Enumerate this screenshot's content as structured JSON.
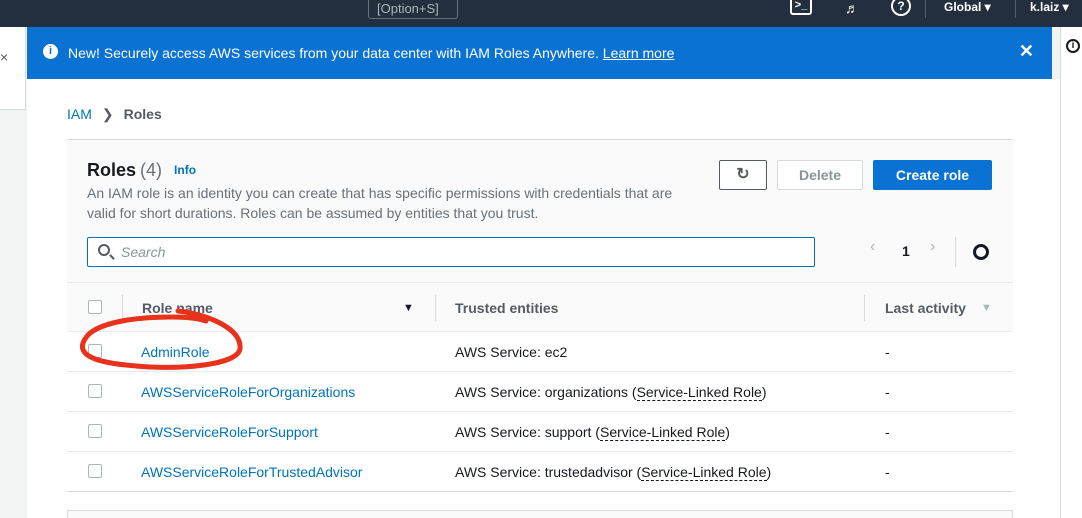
{
  "topnav": {
    "shortcut_hint": "[Option+S]",
    "cloudshell_icon": "cloudshell-icon",
    "bell_icon": "bell-icon",
    "help_icon": "help-icon",
    "region": "Global ▾",
    "user": "k.laiz ▾"
  },
  "banner": {
    "message": "New! Securely access AWS services from your data center with IAM Roles Anywhere.",
    "link": "Learn more",
    "color": "#0972d3"
  },
  "breadcrumb": {
    "root": "IAM",
    "current": "Roles"
  },
  "roles_panel": {
    "title": "Roles",
    "count": "(4)",
    "info_link": "Info",
    "description": "An IAM role is an identity you can create that has specific permissions with credentials that are valid for short durations. Roles can be assumed by entities that you trust.",
    "refresh_icon": "refresh-icon",
    "delete_label": "Delete",
    "create_label": "Create role",
    "search_placeholder": "Search",
    "page_number": "1"
  },
  "table": {
    "columns": [
      "Role name",
      "Trusted entities",
      "Last activity"
    ],
    "rows": [
      {
        "name": "AdminRole",
        "trusted": "AWS Service: ec2",
        "linked": "",
        "last": "-"
      },
      {
        "name": "AWSServiceRoleForOrganizations",
        "trusted": "AWS Service: organizations (",
        "linked": "Service-Linked Role",
        "last": "-"
      },
      {
        "name": "AWSServiceRoleForSupport",
        "trusted": "AWS Service: support (",
        "linked": "Service-Linked Role",
        "last": "-"
      },
      {
        "name": "AWSServiceRoleForTrustedAdvisor",
        "trusted": "AWS Service: trustedadvisor (",
        "linked": "Service-Linked Role",
        "last": "-"
      }
    ]
  },
  "annotation_color": "#e8321c"
}
